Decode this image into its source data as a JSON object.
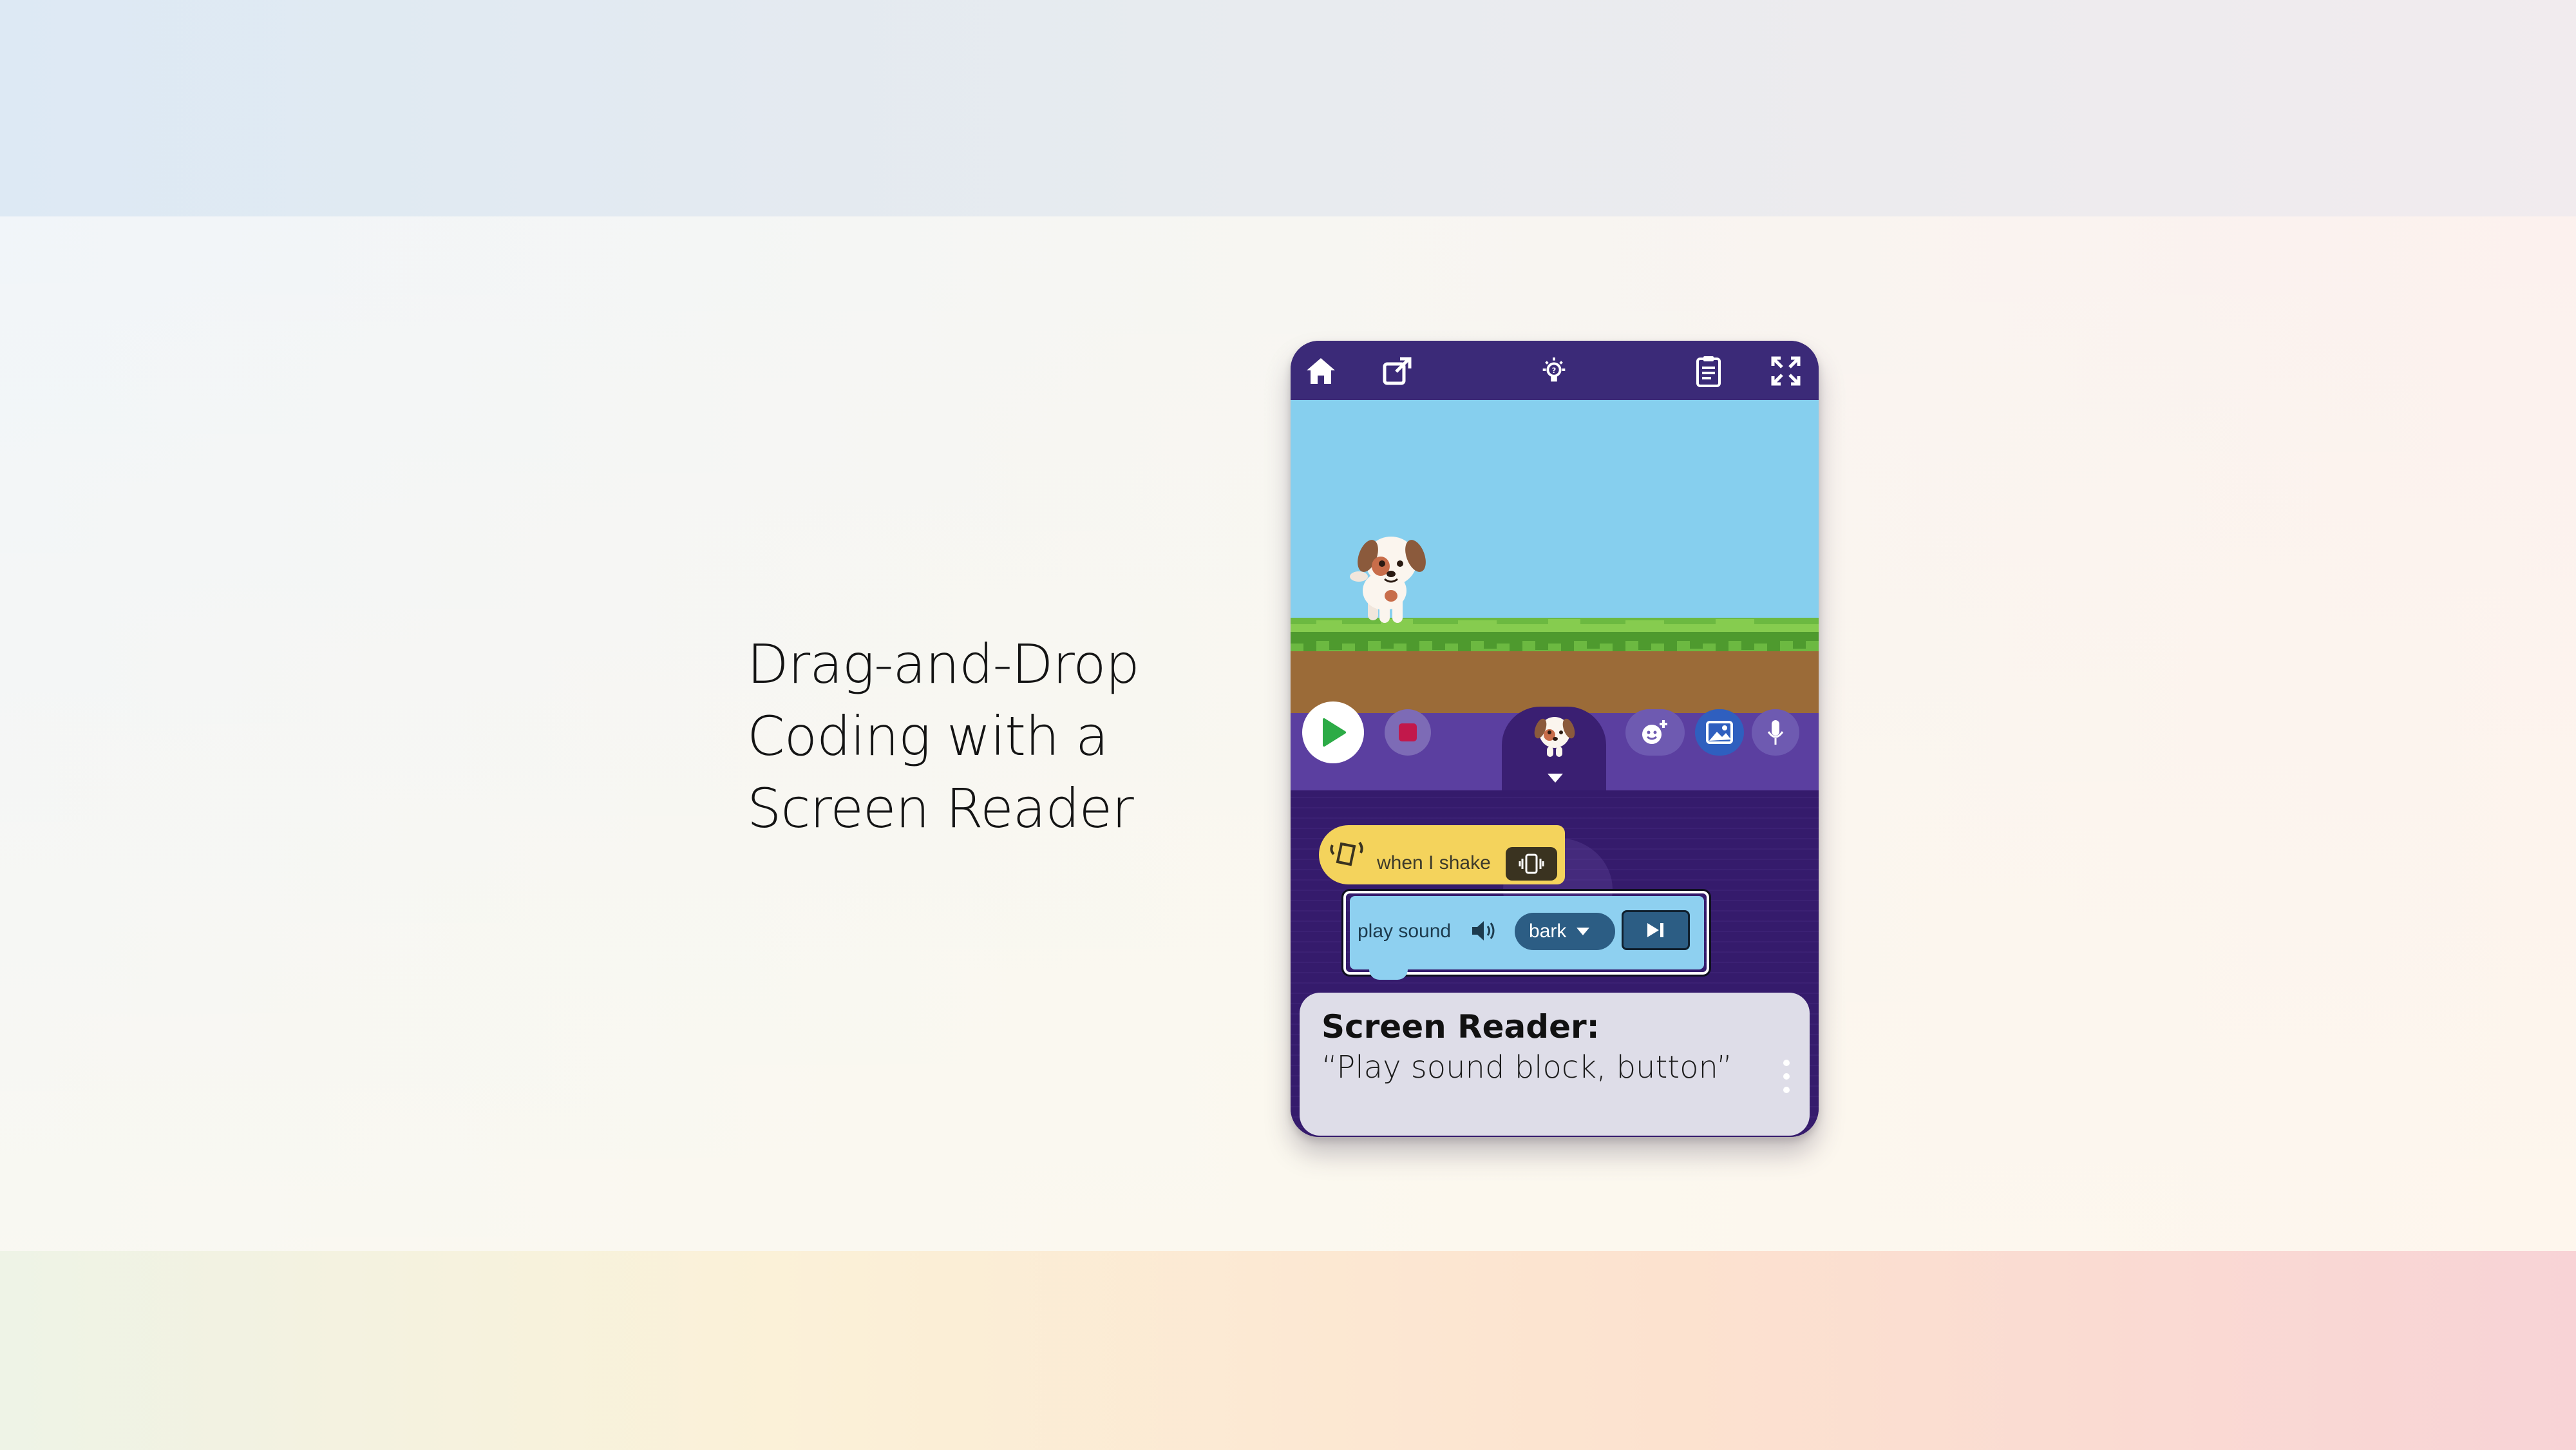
{
  "headline": {
    "line1": "Drag-and-Drop",
    "line2": "Coding with a",
    "line3": "Screen Reader"
  },
  "phone": {
    "topbar_icons": [
      "home-icon",
      "share-icon",
      "hint-lightbulb-icon",
      "project-info-icon",
      "fullscreen-icon"
    ],
    "toolbar_icons": [
      "green-flag-play-icon",
      "stop-icon",
      "dog-sprite",
      "add-character-icon",
      "background-image-icon",
      "microphone-icon"
    ],
    "event_block": {
      "label": "when I shake",
      "icon": "shake-icon",
      "trigger_icon": "phone-vibrate-icon"
    },
    "action_block": {
      "label": "play sound",
      "icon": "speaker-icon",
      "dropdown_value": "bark",
      "play_icon": "skip-forward-icon"
    },
    "screen_reader": {
      "title": "Screen Reader:",
      "text": "“Play sound block, button”"
    }
  },
  "colors": {
    "topbar": "#3b2a78",
    "stage_sky": "#86cfee",
    "grass": "#6cb941",
    "dirt": "#9b6b38",
    "code_area": "#351b6c",
    "event_block": "#f4d35c",
    "action_block": "#8ed0f0",
    "play_green": "#2cab46",
    "stop_red": "#c2184b"
  }
}
